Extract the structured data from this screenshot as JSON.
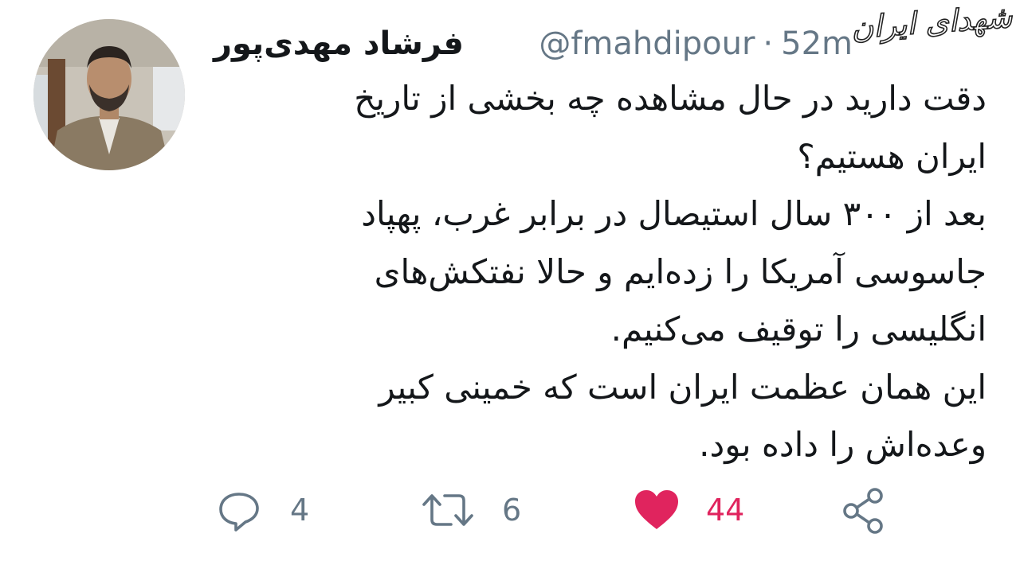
{
  "tweet": {
    "display_name": "فرشاد مهدی‌پور",
    "handle": "@fmahdipour",
    "separator": "·",
    "time": "52m",
    "lines": [
      "دقت دارید در حال مشاهده چه بخشی از تاریخ",
      "ایران هستیم؟",
      "بعد از ۳۰۰ سال استیصال در برابر غرب، پهپاد",
      "جاسوسی آمریکا را زده‌ایم و حالا نفتکش‌های",
      "انگلیسی را توقیف می‌کنیم.",
      "این همان عظمت ایران است که خمینی کبیر",
      "وعده‌اش را داده بود."
    ]
  },
  "actions": {
    "reply_count": "4",
    "retweet_count": "6",
    "like_count": "44",
    "liked": true
  },
  "watermark": "شهدای ایران",
  "icons": {
    "reply": "speech-bubble-icon",
    "retweet": "retweet-arrows-icon",
    "like": "heart-icon",
    "share": "share-icon"
  },
  "colors": {
    "text": "#14171a",
    "secondary": "#657786",
    "like": "#e0245e",
    "background": "#ffffff"
  }
}
